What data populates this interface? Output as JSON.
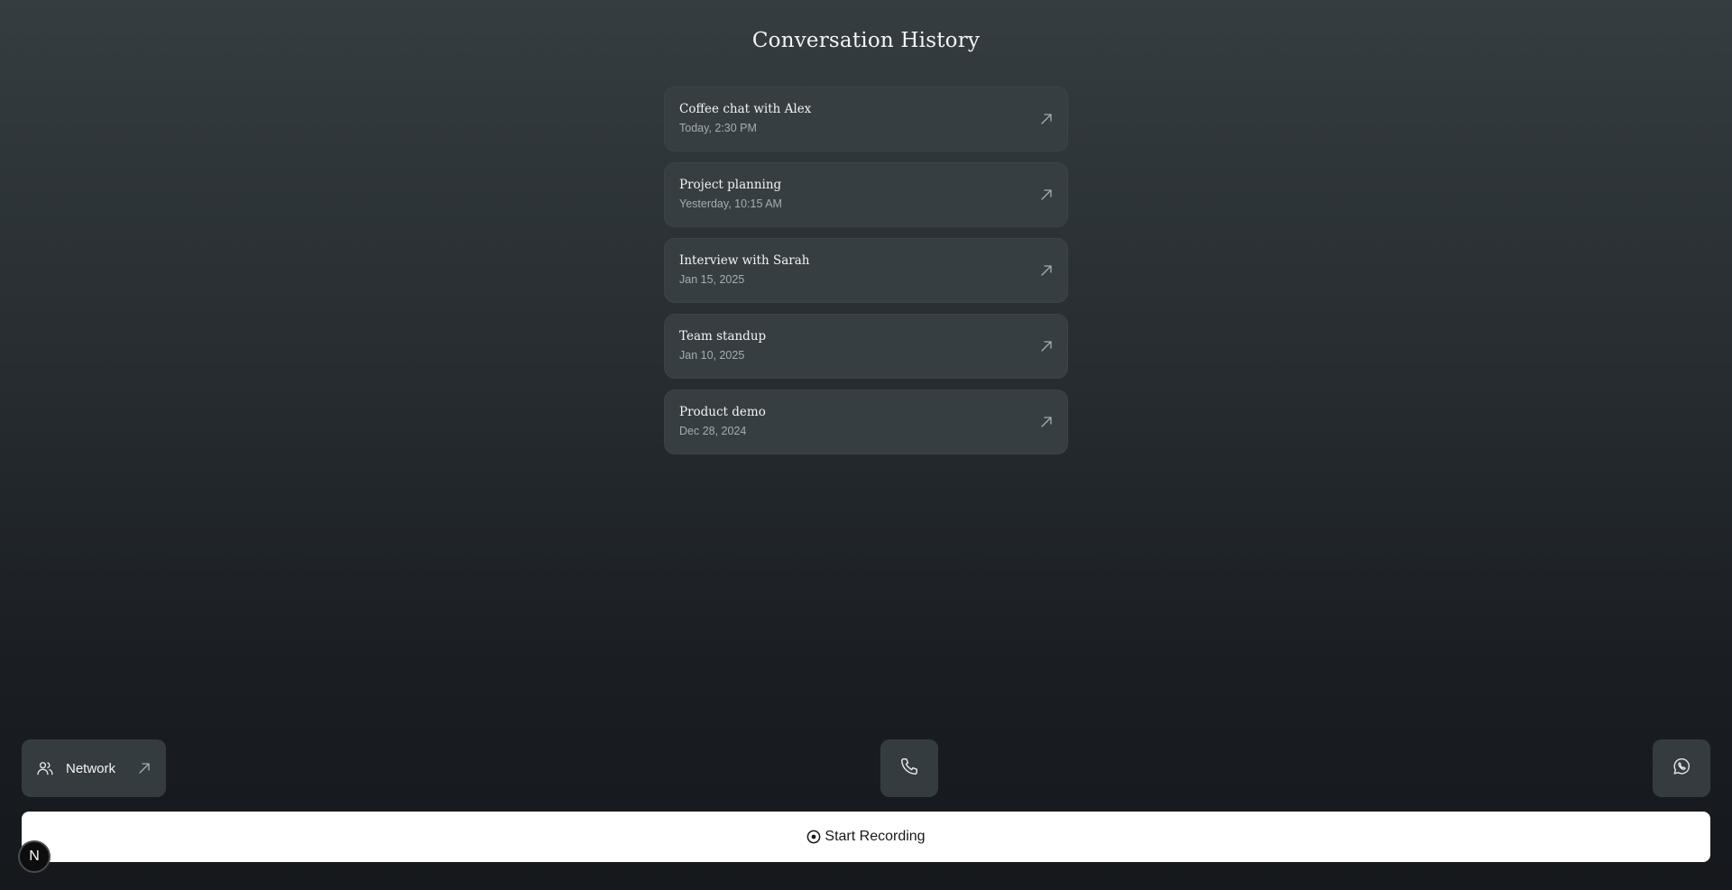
{
  "header": {
    "title": "Conversation History"
  },
  "conversations": [
    {
      "title": "Coffee chat with Alex",
      "date": "Today, 2:30 PM"
    },
    {
      "title": "Project planning",
      "date": "Yesterday, 10:15 AM"
    },
    {
      "title": "Interview with Sarah",
      "date": "Jan 15, 2025"
    },
    {
      "title": "Team standup",
      "date": "Jan 10, 2025"
    },
    {
      "title": "Product demo",
      "date": "Dec 28, 2024"
    }
  ],
  "footer": {
    "network_label": "Network",
    "record_label": "Start Recording",
    "badge_letter": "N"
  },
  "icons": {
    "card_arrow": "arrow-up-right-icon",
    "network": "users-icon",
    "phone": "phone-icon",
    "whatsapp": "whatsapp-icon",
    "record": "record-circle-icon"
  },
  "colors": {
    "card_bg": "#363e42",
    "button_bg": "#353c40",
    "record_bg": "#ffffff",
    "muted_text": "#a5adb2"
  }
}
